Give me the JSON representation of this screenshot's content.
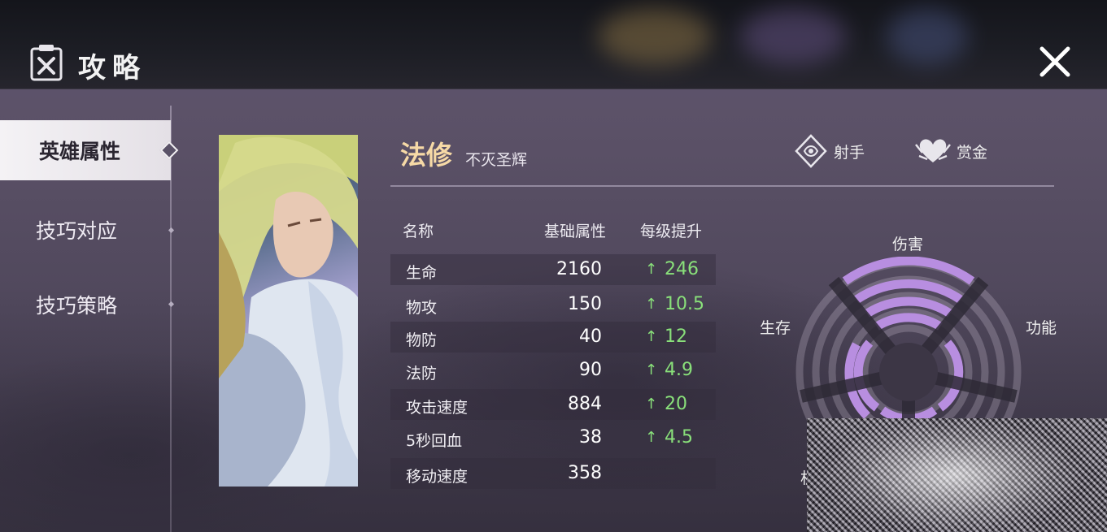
{
  "header": {
    "title": "攻略",
    "icon": "guide-book-icon",
    "close_icon": "close-icon"
  },
  "sidebar": {
    "items": [
      {
        "label": "英雄属性",
        "active": true
      },
      {
        "label": "技巧对应",
        "active": false
      },
      {
        "label": "技巧策略",
        "active": false
      }
    ]
  },
  "hero": {
    "name": "法修",
    "title": "不灭圣辉",
    "roles": [
      {
        "label": "射手",
        "icon": "marksman-icon"
      },
      {
        "label": "赏金",
        "icon": "bounty-icon"
      }
    ]
  },
  "stats": {
    "headers": {
      "name": "名称",
      "base": "基础属性",
      "per_level": "每级提升"
    },
    "rows": [
      {
        "name": "生命",
        "base": "2160",
        "inc": "246"
      },
      {
        "name": "物攻",
        "base": "150",
        "inc": "10.5"
      },
      {
        "name": "物防",
        "base": "40",
        "inc": "12"
      },
      {
        "name": "法防",
        "base": "90",
        "inc": "4.9"
      },
      {
        "name": "攻击速度",
        "base": "884",
        "inc": "20"
      },
      {
        "name": "5秒回血",
        "base": "38",
        "inc": "4.5"
      },
      {
        "name": "移动速度",
        "base": "358",
        "inc": ""
      }
    ]
  },
  "radar": {
    "labels": {
      "top": "伤害",
      "left": "生存",
      "right": "功能",
      "bottom_left": "机动"
    },
    "accent": "#b88ee0"
  },
  "colors": {
    "hero_name": "#f6d9a6",
    "increase": "#89e07a"
  }
}
